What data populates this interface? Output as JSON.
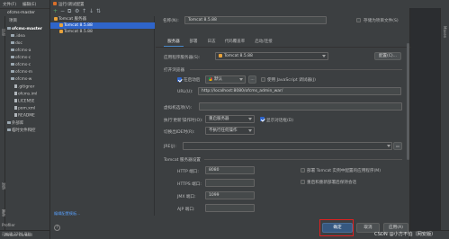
{
  "ide": {
    "menu": [
      "文件(F)",
      "编辑(E)"
    ],
    "project_name": "ofcms-master",
    "project_label": "项目",
    "tree": [
      {
        "label": "ofcms-master",
        "type": "folder"
      },
      {
        "label": ".idea",
        "type": "folder"
      },
      {
        "label": "doc",
        "type": "folder"
      },
      {
        "label": "ofcms-a",
        "type": "folder"
      },
      {
        "label": "ofcms-c",
        "type": "folder"
      },
      {
        "label": "ofcms-c",
        "type": "folder"
      },
      {
        "label": "ofcms-m",
        "type": "folder"
      },
      {
        "label": "ofcms-w",
        "type": "folder"
      },
      {
        "label": ".gitignor",
        "type": "file"
      },
      {
        "label": "ofcms.iml",
        "type": "file"
      },
      {
        "label": "LICENSE",
        "type": "file"
      },
      {
        "label": "pom.xml",
        "type": "file"
      },
      {
        "label": "README",
        "type": "file"
      },
      {
        "label": "外部库",
        "type": "folder"
      },
      {
        "label": "临时文件和控",
        "type": "folder"
      }
    ],
    "left_strip_labels": [
      "项目",
      "结构",
      "收藏"
    ],
    "right_strip_label": "Maven",
    "status": [
      "Version Control",
      "Profiler",
      "已构建 2284 毫秒"
    ]
  },
  "dialog": {
    "title": "运行/调试配置",
    "toolbar": [
      "+",
      "−",
      "⧉",
      "⚙",
      "↑",
      "↓",
      "⇅"
    ],
    "tree": [
      {
        "label": "Tomcat 服务器",
        "selected": false
      },
      {
        "label": "Tomcat 8.5.88",
        "selected": true
      },
      {
        "label": "Tomcat 8.5.88",
        "selected": false
      }
    ],
    "edit_templates": "编辑配置模板...",
    "name_label": "名称(N):",
    "name_value": "Tomcat 8.5.88",
    "store_project_file": "存储为项目文件(S)",
    "tabs": [
      "服务器",
      "部署",
      "日志",
      "代码覆盖率",
      "启动/连接"
    ],
    "app_server_label": "应用程序服务器(S):",
    "app_server_value": "Tomcat 8.5.88",
    "configure_button": "配置(C)...",
    "open_browser_section": "打开浏览器",
    "after_launch_label": "在启动后",
    "browser_value": "默认",
    "browser_more": "...",
    "js_debugger_label": "使用 JavaScript 调试器(J)",
    "url_label": "URL(U):",
    "url_value": "http://localhost:8080/ofcms_admin_war/",
    "vm_options_label": "虚拟机选项(V):",
    "on_update_label": "执行'更新'操作时(O):",
    "on_update_value": "重启服务器",
    "show_dialog_label": "显示对话框(D)",
    "on_frame_label": "切换出IDE时(R):",
    "on_frame_value": "不执行任何操作",
    "jre_label": "JRE(J):",
    "tomcat_settings_section": "Tomcat 服务器设置",
    "http_port_label": "HTTP 端口:",
    "http_port_value": "8080",
    "https_port_label": "HTTPS 端口:",
    "https_port_value": "",
    "jmx_port_label": "JMX 端口:",
    "jmx_port_value": "1099",
    "ajp_port_label": "AJP 端口:",
    "ajp_port_value": "",
    "deploy_apps_label": "部署 Tomcat 实例中配置的应用程序(M)",
    "preserve_sessions_label": "重启和重新部署后保持会话",
    "help": "?",
    "ok_button": "确定",
    "cancel_button": "取消",
    "apply_button": "应用(A)"
  },
  "watermark": "CSDN @小方不怕（网安版）",
  "colors": {
    "accent": "#2f65ca",
    "primary_button": "#365880",
    "highlight_frame": "#e02020",
    "link": "#589df6"
  }
}
